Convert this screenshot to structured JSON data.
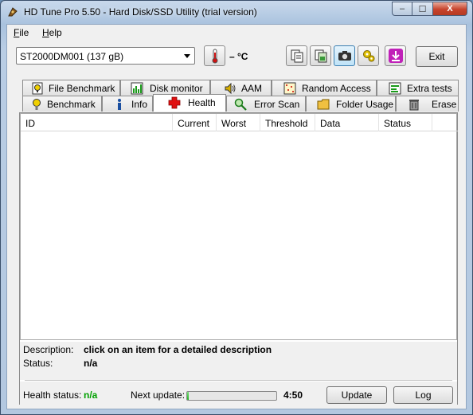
{
  "window": {
    "title": "HD Tune Pro 5.50 - Hard Disk/SSD Utility (trial version)",
    "close_symbol": "X",
    "minimize_symbol": "–",
    "maximize_symbol": "☐"
  },
  "menu": {
    "file_first": "F",
    "file_rest": "ile",
    "help_first": "H",
    "help_rest": "elp"
  },
  "toolbar": {
    "drive": "ST2000DM001 (137 gB)",
    "temperature": "– °C",
    "exit_label": "Exit"
  },
  "tabs_top": [
    {
      "label": "File Benchmark",
      "icon": "file-benchmark-icon"
    },
    {
      "label": "Disk monitor",
      "icon": "disk-monitor-icon"
    },
    {
      "label": "AAM",
      "icon": "speaker-icon"
    },
    {
      "label": "Random Access",
      "icon": "random-access-icon"
    },
    {
      "label": "Extra tests",
      "icon": "extra-tests-icon"
    }
  ],
  "tabs_bottom": [
    {
      "label": "Benchmark",
      "icon": "benchmark-icon"
    },
    {
      "label": "Info",
      "icon": "info-icon"
    },
    {
      "label": "Health",
      "icon": "health-cross-icon"
    },
    {
      "label": "Error Scan",
      "icon": "magnifier-icon"
    },
    {
      "label": "Folder Usage",
      "icon": "folder-icon"
    },
    {
      "label": "Erase",
      "icon": "trash-icon"
    }
  ],
  "grid": {
    "columns": [
      "ID",
      "Current",
      "Worst",
      "Threshold",
      "Data",
      "Status"
    ]
  },
  "details": {
    "description_label": "Description:",
    "description_value": "click on an item for a detailed description",
    "status_label": "Status:",
    "status_value": "n/a"
  },
  "footer": {
    "health_label": "Health status:",
    "health_value": "n/a",
    "next_update_label": "Next update:",
    "progress_fraction": 0.02,
    "time_left": "4:50",
    "update_label": "Update",
    "log_label": "Log"
  },
  "colors": {
    "health_ok": "#00a000",
    "accent": "#3c7fb1"
  }
}
